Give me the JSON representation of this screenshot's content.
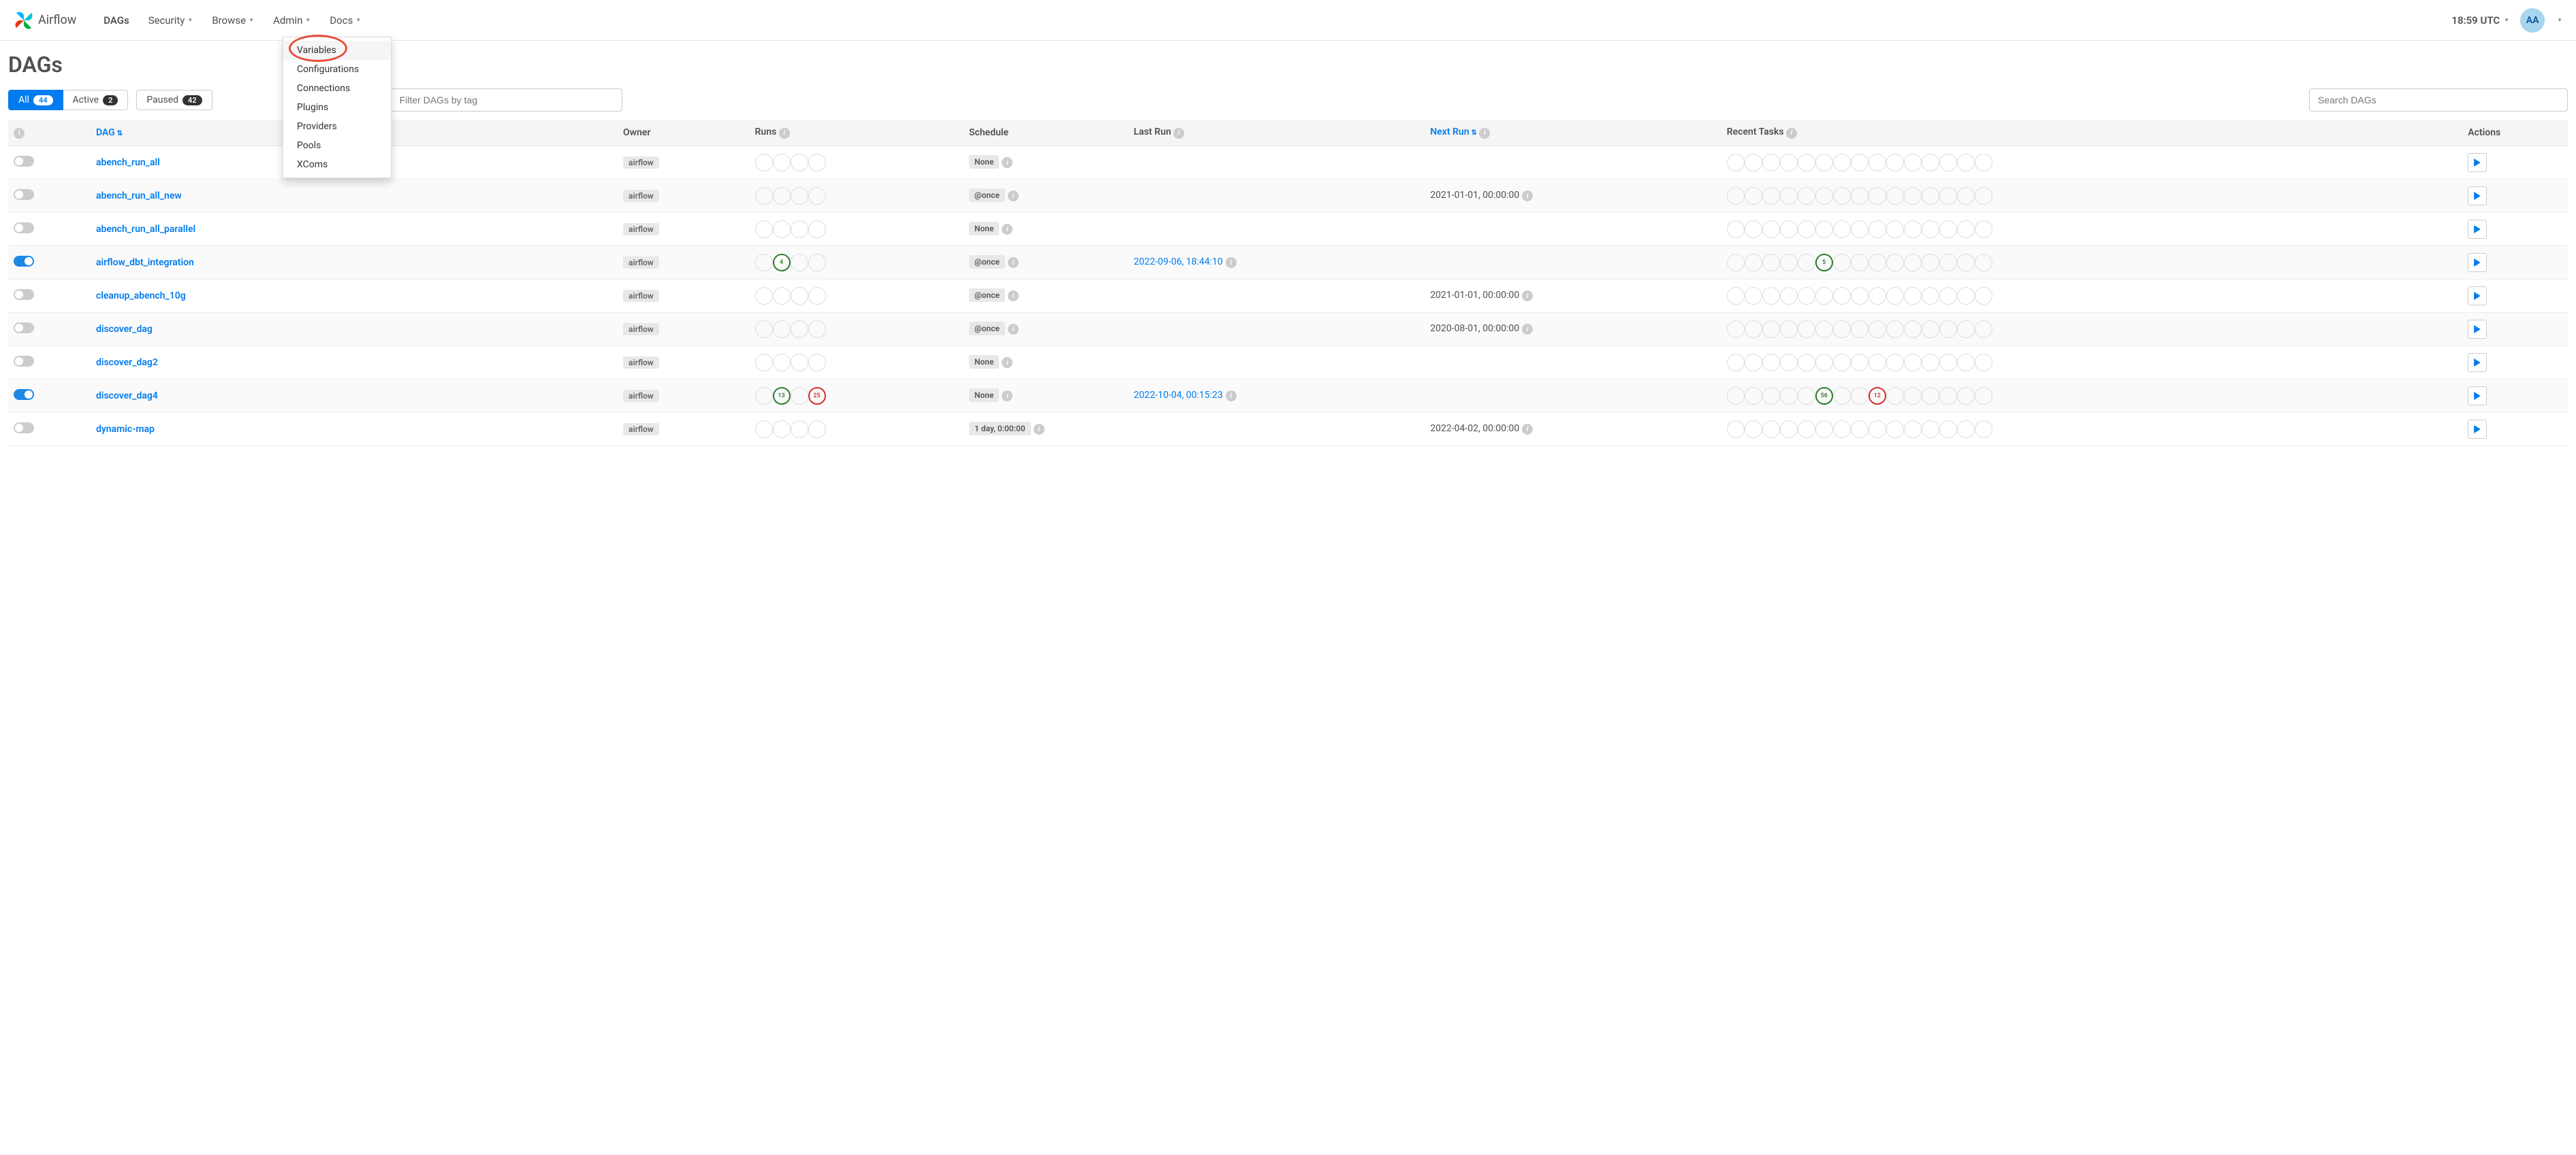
{
  "brand": "Airflow",
  "nav": {
    "dags": "DAGs",
    "security": "Security",
    "browse": "Browse",
    "admin": "Admin",
    "docs": "Docs"
  },
  "clock": "18:59 UTC",
  "user_initials": "AA",
  "admin_menu": {
    "variables": "Variables",
    "configurations": "Configurations",
    "connections": "Connections",
    "plugins": "Plugins",
    "providers": "Providers",
    "pools": "Pools",
    "xcoms": "XComs"
  },
  "page_title": "DAGs",
  "filters": {
    "all_label": "All",
    "all_count": "44",
    "active_label": "Active",
    "active_count": "2",
    "paused_label": "Paused",
    "paused_count": "42",
    "tag_placeholder": "Filter DAGs by tag",
    "search_placeholder": "Search DAGs"
  },
  "headers": {
    "dag": "DAG",
    "owner": "Owner",
    "runs": "Runs",
    "schedule": "Schedule",
    "last_run": "Last Run",
    "next_run": "Next Run",
    "recent_tasks": "Recent Tasks",
    "actions": "Actions"
  },
  "rows": [
    {
      "on": false,
      "name": "abench_run_all",
      "owner": "airflow",
      "runs": [
        "",
        "",
        "",
        ""
      ],
      "schedule": "None",
      "last_run": "",
      "next_run": "",
      "tasks": [
        "",
        "",
        "",
        "",
        "",
        "",
        "",
        "",
        "",
        "",
        "",
        "",
        "",
        "",
        ""
      ]
    },
    {
      "on": false,
      "name": "abench_run_all_new",
      "owner": "airflow",
      "runs": [
        "",
        "",
        "",
        ""
      ],
      "schedule": "@once",
      "last_run": "",
      "next_run": "2021-01-01, 00:00:00",
      "tasks": [
        "",
        "",
        "",
        "",
        "",
        "",
        "",
        "",
        "",
        "",
        "",
        "",
        "",
        "",
        ""
      ]
    },
    {
      "on": false,
      "name": "abench_run_all_parallel",
      "owner": "airflow",
      "runs": [
        "",
        "",
        "",
        ""
      ],
      "schedule": "None",
      "last_run": "",
      "next_run": "",
      "tasks": [
        "",
        "",
        "",
        "",
        "",
        "",
        "",
        "",
        "",
        "",
        "",
        "",
        "",
        "",
        ""
      ]
    },
    {
      "on": true,
      "name": "airflow_dbt_integration",
      "owner": "airflow",
      "runs": [
        "",
        {
          "v": "4",
          "c": "green"
        },
        "",
        ""
      ],
      "schedule": "@once",
      "last_run": "2022-09-06, 18:44:10",
      "next_run": "",
      "tasks": [
        "",
        "",
        "",
        "",
        "",
        {
          "v": "5",
          "c": "green"
        },
        "",
        "",
        "",
        "",
        "",
        "",
        "",
        "",
        ""
      ]
    },
    {
      "on": false,
      "name": "cleanup_abench_10g",
      "owner": "airflow",
      "runs": [
        "",
        "",
        "",
        ""
      ],
      "schedule": "@once",
      "last_run": "",
      "next_run": "2021-01-01, 00:00:00",
      "tasks": [
        "",
        "",
        "",
        "",
        "",
        "",
        "",
        "",
        "",
        "",
        "",
        "",
        "",
        "",
        ""
      ]
    },
    {
      "on": false,
      "name": "discover_dag",
      "owner": "airflow",
      "runs": [
        "",
        "",
        "",
        ""
      ],
      "schedule": "@once",
      "last_run": "",
      "next_run": "2020-08-01, 00:00:00",
      "tasks": [
        "",
        "",
        "",
        "",
        "",
        "",
        "",
        "",
        "",
        "",
        "",
        "",
        "",
        "",
        ""
      ]
    },
    {
      "on": false,
      "name": "discover_dag2",
      "owner": "airflow",
      "runs": [
        "",
        "",
        "",
        ""
      ],
      "schedule": "None",
      "last_run": "",
      "next_run": "",
      "tasks": [
        "",
        "",
        "",
        "",
        "",
        "",
        "",
        "",
        "",
        "",
        "",
        "",
        "",
        "",
        ""
      ]
    },
    {
      "on": true,
      "name": "discover_dag4",
      "owner": "airflow",
      "runs": [
        "",
        {
          "v": "13",
          "c": "green"
        },
        "",
        {
          "v": "25",
          "c": "red"
        }
      ],
      "schedule": "None",
      "last_run": "2022-10-04, 00:15:23",
      "next_run": "",
      "tasks": [
        "",
        "",
        "",
        "",
        "",
        {
          "v": "56",
          "c": "green"
        },
        "",
        "",
        {
          "v": "12",
          "c": "red"
        },
        "",
        "",
        "",
        "",
        "",
        ""
      ]
    },
    {
      "on": false,
      "name": "dynamic-map",
      "owner": "airflow",
      "runs": [
        "",
        "",
        "",
        ""
      ],
      "schedule": "1 day, 0:00:00",
      "last_run": "",
      "next_run": "2022-04-02, 00:00:00",
      "tasks": [
        "",
        "",
        "",
        "",
        "",
        "",
        "",
        "",
        "",
        "",
        "",
        "",
        "",
        "",
        ""
      ]
    }
  ]
}
